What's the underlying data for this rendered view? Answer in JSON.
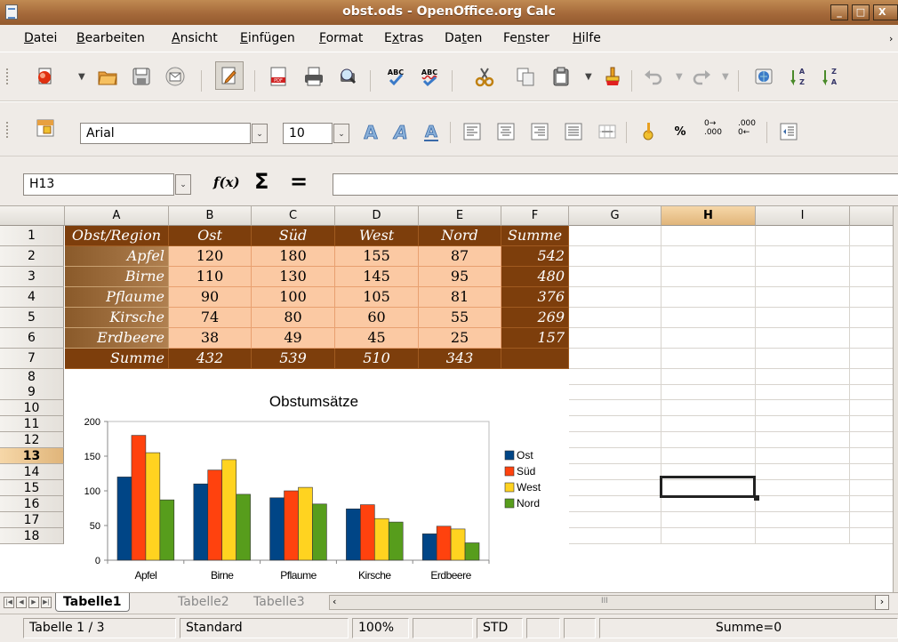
{
  "window": {
    "title": "obst.ods - OpenOffice.org Calc",
    "btn_min": "_",
    "btn_max": "□",
    "btn_close": "X"
  },
  "menu": [
    {
      "label": "Datei",
      "ul": "D"
    },
    {
      "label": "Bearbeiten",
      "ul": "B"
    },
    {
      "label": "Ansicht",
      "ul": "A"
    },
    {
      "label": "Einfügen",
      "ul": "E"
    },
    {
      "label": "Format",
      "ul": "F"
    },
    {
      "label": "Extras",
      "ul": "x"
    },
    {
      "label": "Daten",
      "ul": "t"
    },
    {
      "label": "Fenster",
      "ul": "n"
    },
    {
      "label": "Hilfe",
      "ul": "H"
    }
  ],
  "format_bar": {
    "font_name": "Arial",
    "font_size": "10",
    "percent_label": "%",
    "add_decimal_label": "0→\n.000",
    "del_decimal_label": ".000\n0←"
  },
  "formula_bar": {
    "cell_ref": "H13",
    "fx_label": "f(x)",
    "sum_label": "Σ",
    "equals_label": "=",
    "formula": ""
  },
  "columns": [
    "A",
    "B",
    "C",
    "D",
    "E",
    "F",
    "G",
    "H",
    "I"
  ],
  "selected_column": "H",
  "rows": [
    "1",
    "2",
    "3",
    "4",
    "5",
    "6",
    "7",
    "8",
    "9",
    "10",
    "11",
    "12",
    "13",
    "14",
    "15",
    "16",
    "17",
    "18"
  ],
  "selected_row": "13",
  "table": {
    "header": [
      "Obst/Region",
      "Ost",
      "Süd",
      "West",
      "Nord",
      "Summe"
    ],
    "body": [
      [
        "Apfel",
        "120",
        "180",
        "155",
        "87",
        "542"
      ],
      [
        "Birne",
        "110",
        "130",
        "145",
        "95",
        "480"
      ],
      [
        "Pflaume",
        "90",
        "100",
        "105",
        "81",
        "376"
      ],
      [
        "Kirsche",
        "74",
        "80",
        "60",
        "55",
        "269"
      ],
      [
        "Erdbeere",
        "38",
        "49",
        "45",
        "25",
        "157"
      ]
    ],
    "totals": [
      "Summe",
      "432",
      "539",
      "510",
      "343",
      ""
    ]
  },
  "chart_data": {
    "type": "bar",
    "title": "Obstumsätze",
    "categories": [
      "Apfel",
      "Birne",
      "Pflaume",
      "Kirsche",
      "Erdbeere"
    ],
    "series": [
      {
        "name": "Ost",
        "values": [
          120,
          110,
          90,
          74,
          38
        ],
        "color": "#004586"
      },
      {
        "name": "Süd",
        "values": [
          180,
          130,
          100,
          80,
          49
        ],
        "color": "#ff420e"
      },
      {
        "name": "West",
        "values": [
          155,
          145,
          105,
          60,
          45
        ],
        "color": "#ffd320"
      },
      {
        "name": "Nord",
        "values": [
          87,
          95,
          81,
          55,
          25
        ],
        "color": "#579d1c"
      }
    ],
    "ylim": [
      0,
      200
    ],
    "yticks": [
      0,
      50,
      100,
      150,
      200
    ],
    "legend": "right",
    "grid": false
  },
  "sheet_tabs": [
    "Tabelle1",
    "Tabelle2",
    "Tabelle3"
  ],
  "active_tab": "Tabelle1",
  "status": {
    "sheet": "Tabelle 1 / 3",
    "style": "Standard",
    "zoom": "100%",
    "mode": "STD",
    "sum": "Summe=0"
  }
}
